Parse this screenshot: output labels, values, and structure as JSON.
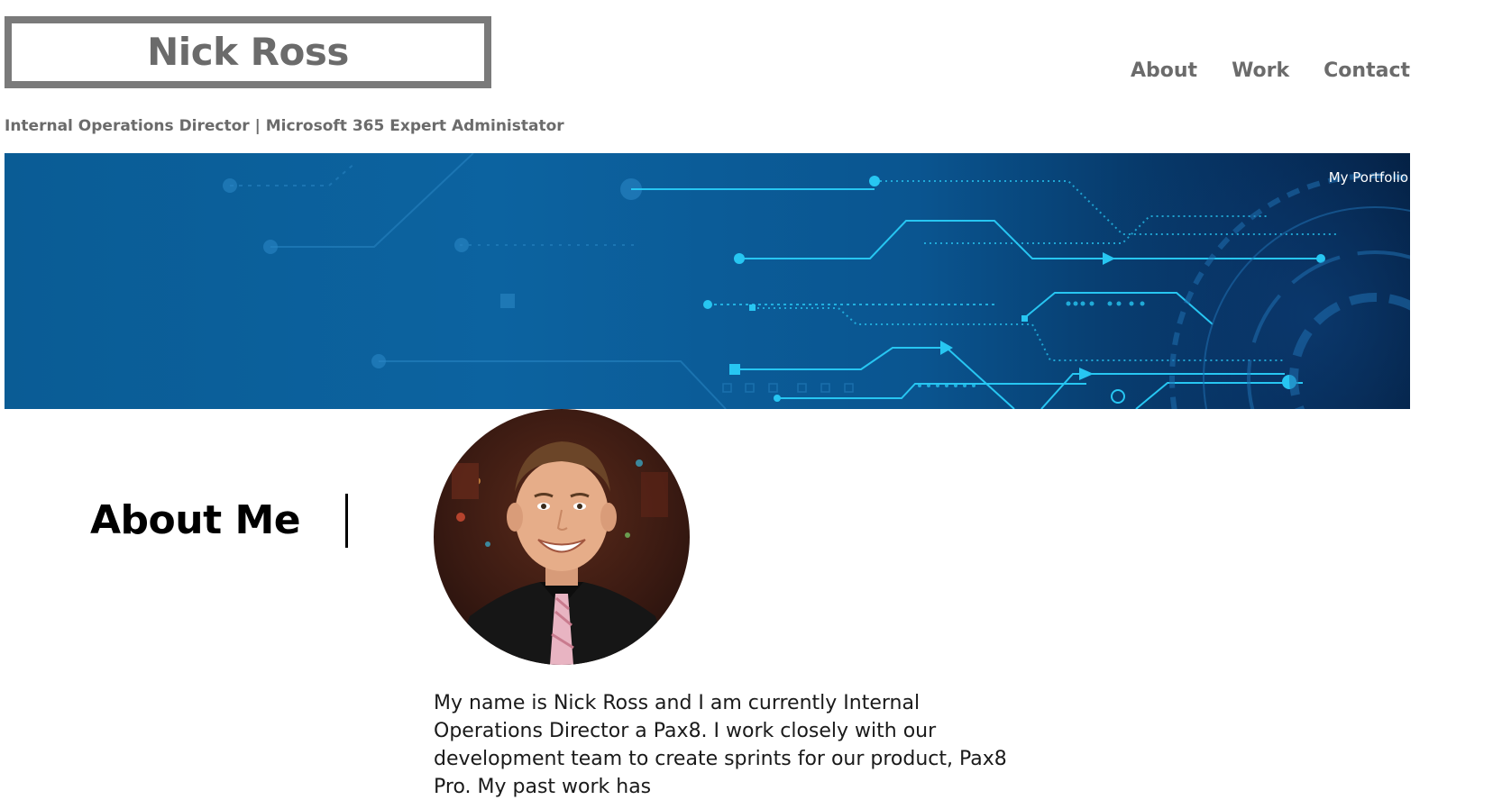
{
  "header": {
    "logo_text": "Nick Ross",
    "tagline": "Internal Operations Director | Microsoft 365 Expert Administator"
  },
  "nav": {
    "items": [
      {
        "label": "About"
      },
      {
        "label": "Work"
      },
      {
        "label": "Contact"
      }
    ]
  },
  "banner": {
    "label": "My Portfolio"
  },
  "about": {
    "heading": "About Me",
    "bio": "My name is Nick Ross and I am currently Internal Operations Director a Pax8. I work closely with our development team to create sprints for our product, Pax8 Pro. My past work has"
  },
  "colors": {
    "text_gray": "#6b6b6b",
    "banner_blue": "#0a5c95",
    "circuit_cyan": "#27c6f2"
  }
}
